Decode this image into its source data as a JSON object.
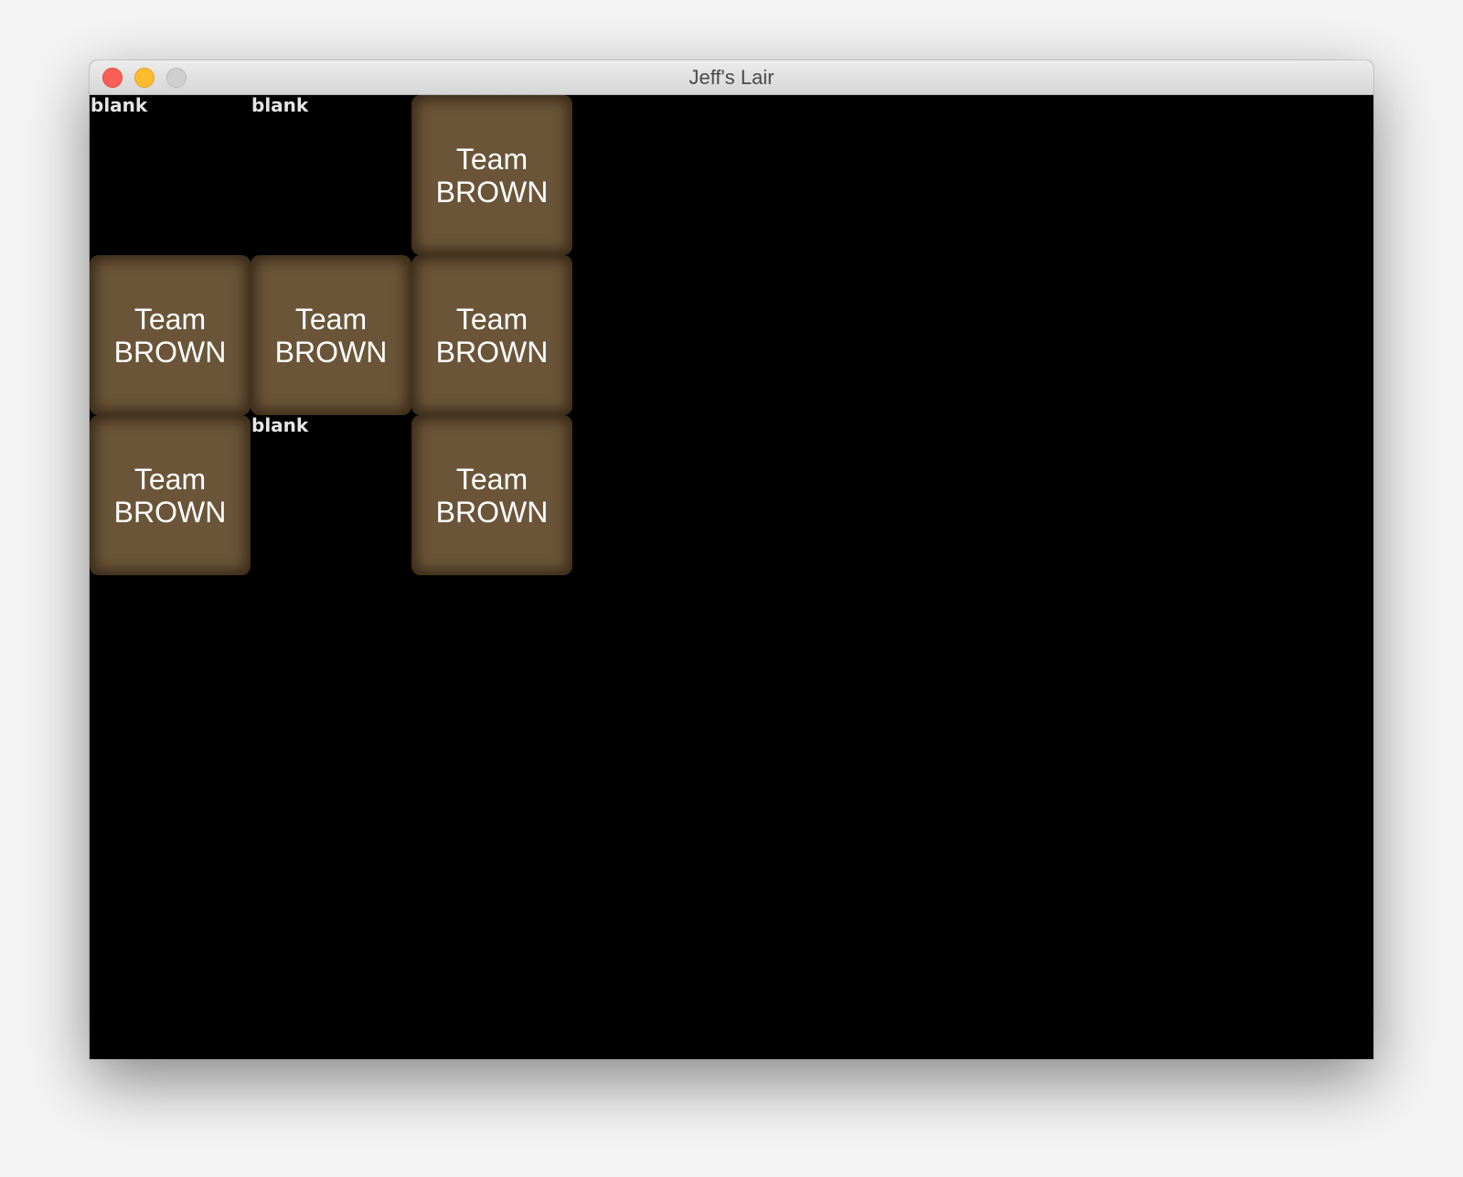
{
  "window": {
    "title": "Jeff's Lair"
  },
  "board": {
    "cells": [
      {
        "type": "blank",
        "label": "blank"
      },
      {
        "type": "blank",
        "label": "blank"
      },
      {
        "type": "tile",
        "line1": "Team",
        "line2": "BROWN"
      },
      {
        "type": "tile",
        "line1": "Team",
        "line2": "BROWN"
      },
      {
        "type": "tile",
        "line1": "Team",
        "line2": "BROWN"
      },
      {
        "type": "tile",
        "line1": "Team",
        "line2": "BROWN"
      },
      {
        "type": "tile",
        "line1": "Team",
        "line2": "BROWN"
      },
      {
        "type": "blank",
        "label": "blank"
      },
      {
        "type": "tile",
        "line1": "Team",
        "line2": "BROWN"
      }
    ],
    "colors": {
      "tile": "#6b5538",
      "background": "#000000"
    }
  }
}
